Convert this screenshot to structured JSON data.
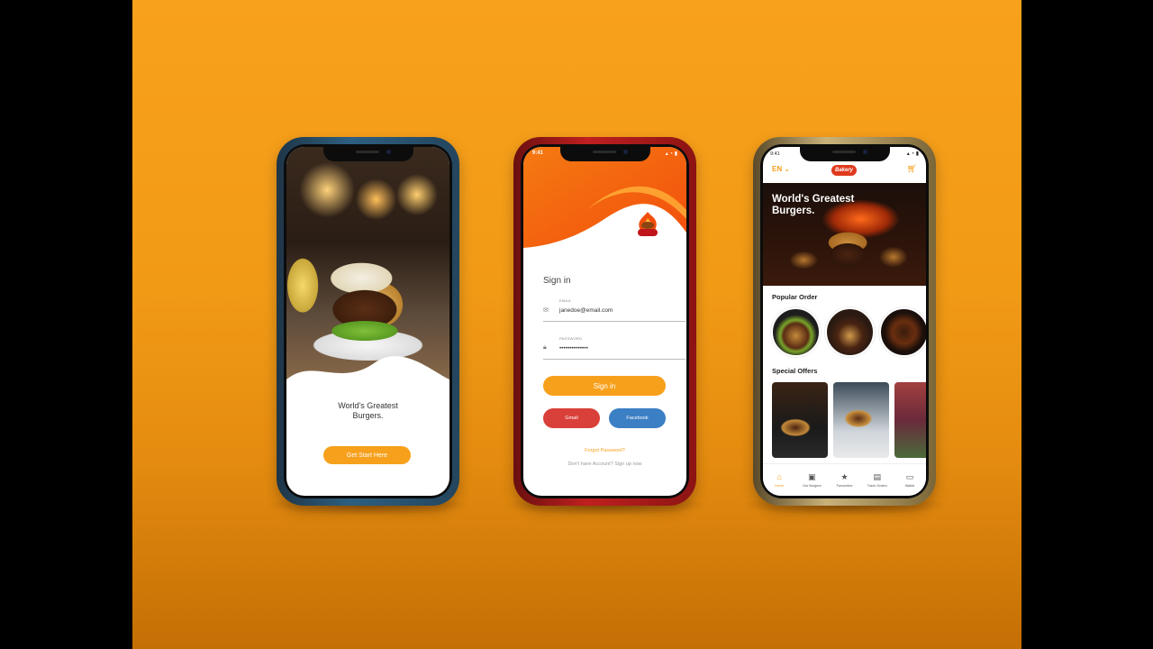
{
  "colors": {
    "accent": "#f7a01c",
    "gmail": "#d9403a",
    "facebook": "#3b7fc4",
    "background": "#f19a16"
  },
  "screen1": {
    "headline_line1": "World's Greatest",
    "headline_line2": "Burgers.",
    "cta": "Get Start Here"
  },
  "screen2": {
    "time": "9:41",
    "title": "Sign in",
    "email": {
      "label": "EMAIL",
      "value": "janedoe@email.com"
    },
    "password": {
      "label": "PASSWORD",
      "value": "••••••••••••••"
    },
    "signin": "Sign in",
    "gmail": "Gmail",
    "facebook": "Facebook",
    "forgot": "Forgot Password?",
    "signup": "Don't have Account? Sign up now"
  },
  "screen3": {
    "time": "9:41",
    "language": "EN",
    "logo": "Bakery",
    "hero_line1": "World's Greatest",
    "hero_line2": "Burgers.",
    "popular": "Popular Order",
    "special": "Special Offers",
    "tabs": [
      {
        "label": "Home",
        "icon": "home-icon"
      },
      {
        "label": "Our Burgers",
        "icon": "menu-book-icon"
      },
      {
        "label": "Favourites",
        "icon": "star-icon"
      },
      {
        "label": "Track Orders",
        "icon": "track-icon"
      },
      {
        "label": "Wallet",
        "icon": "wallet-icon"
      }
    ]
  }
}
